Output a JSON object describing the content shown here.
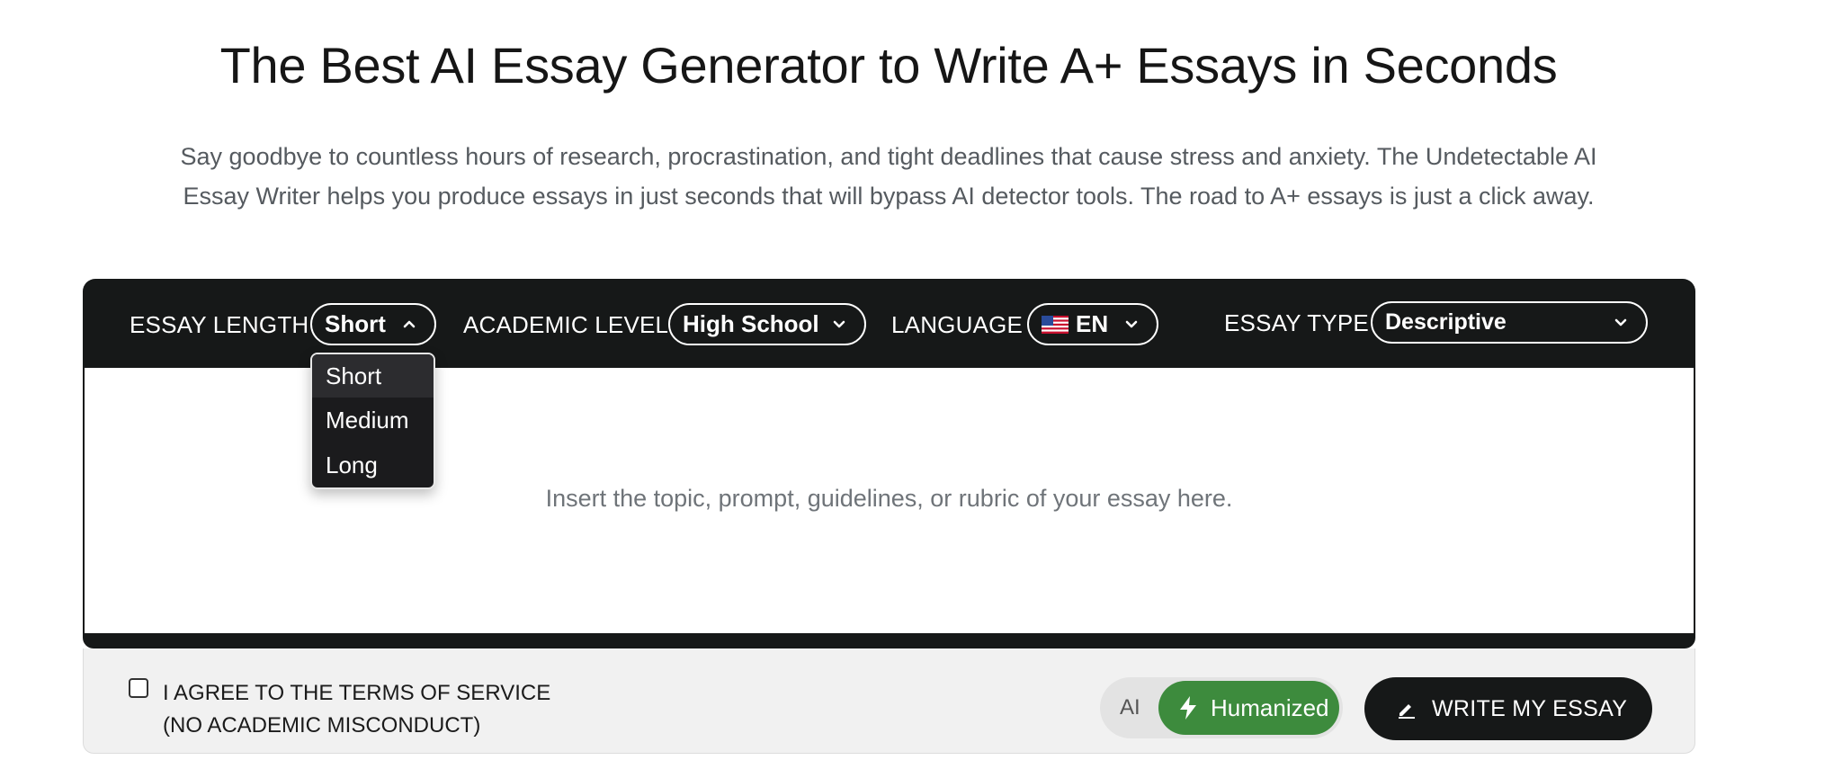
{
  "hero": {
    "title": "The Best AI Essay Generator to Write A+ Essays in Seconds",
    "subtitle_line1": "Say goodbye to countless hours of research, procrastination, and tight deadlines that cause stress and anxiety. The Undetectable AI",
    "subtitle_line2": "Essay Writer helps you produce essays in just seconds that will bypass AI detector tools. The road to A+ essays is just a click away."
  },
  "toolbar": {
    "essay_length_label": "ESSAY LENGTH",
    "essay_length_value": "Short",
    "academic_level_label": "ACADEMIC LEVEL",
    "academic_level_value": "High School",
    "language_label": "LANGUAGE",
    "language_value": "EN",
    "essay_type_label": "ESSAY TYPE",
    "essay_type_value": "Descriptive"
  },
  "length_dropdown": {
    "options": [
      "Short",
      "Medium",
      "Long"
    ],
    "selected": "Short"
  },
  "editor": {
    "placeholder": "Insert the topic, prompt, guidelines, or rubric of your essay here."
  },
  "footer": {
    "terms_line1": "I AGREE TO THE TERMS OF SERVICE",
    "terms_line2": "(NO ACADEMIC MISCONDUCT)",
    "mode_ai": "AI",
    "mode_humanized": "Humanized",
    "write_button": "WRITE MY ESSAY"
  },
  "colors": {
    "toolbar_bg": "#161818",
    "humanized_green": "#3d8b3d",
    "footer_bg": "#f1f1f1"
  },
  "icons": {
    "length_chevron": "chevron-up-icon",
    "level_chevron": "chevron-down-icon",
    "language_flag": "us-flag-icon",
    "humanized": "lightning-bolt-icon",
    "write": "pencil-icon"
  }
}
